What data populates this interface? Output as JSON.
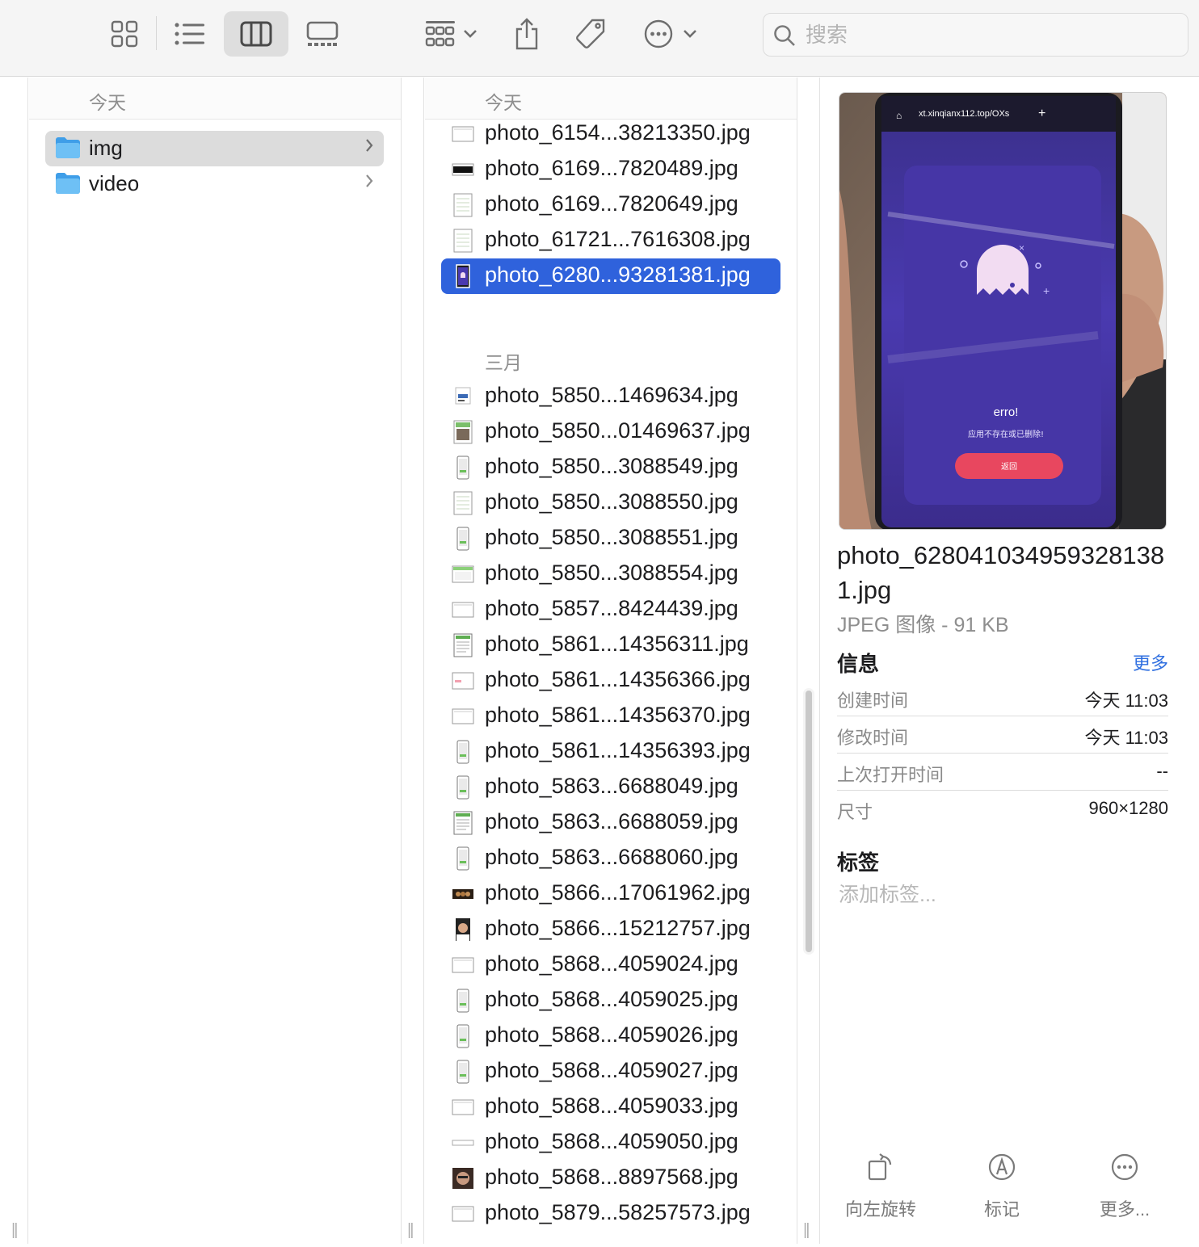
{
  "toolbar": {
    "view_buttons": [
      "icon-view-icon",
      "list-view-icon",
      "column-view-icon",
      "gallery-view-icon"
    ],
    "search_placeholder": "搜索"
  },
  "column1": {
    "header": "今天",
    "items": [
      {
        "label": "img",
        "selected": true
      },
      {
        "label": "video",
        "selected": false
      }
    ]
  },
  "column2": {
    "header": "今天",
    "today_files": [
      {
        "label": "photo_6154...38213350.jpg",
        "thumb": "white"
      },
      {
        "label": "photo_6169...7820489.jpg",
        "thumb": "dark-bar"
      },
      {
        "label": "photo_6169...7820649.jpg",
        "thumb": "doc"
      },
      {
        "label": "photo_61721...7616308.jpg",
        "thumb": "doc"
      },
      {
        "label": "photo_6280...93281381.jpg",
        "thumb": "phone-purple",
        "selected": true
      }
    ],
    "section_march": "三月",
    "march_files": [
      {
        "label": "photo_5850...1469634.jpg",
        "thumb": "small"
      },
      {
        "label": "photo_5850...01469637.jpg",
        "thumb": "photo"
      },
      {
        "label": "photo_5850...3088549.jpg",
        "thumb": "phone"
      },
      {
        "label": "photo_5850...3088550.jpg",
        "thumb": "doc"
      },
      {
        "label": "photo_5850...3088551.jpg",
        "thumb": "phone"
      },
      {
        "label": "photo_5850...3088554.jpg",
        "thumb": "wide-green"
      },
      {
        "label": "photo_5857...8424439.jpg",
        "thumb": "white"
      },
      {
        "label": "photo_5861...14356311.jpg",
        "thumb": "doc-green"
      },
      {
        "label": "photo_5861...14356366.jpg",
        "thumb": "white-pink"
      },
      {
        "label": "photo_5861...14356370.jpg",
        "thumb": "white"
      },
      {
        "label": "photo_5861...14356393.jpg",
        "thumb": "phone"
      },
      {
        "label": "photo_5863...6688049.jpg",
        "thumb": "phone"
      },
      {
        "label": "photo_5863...6688059.jpg",
        "thumb": "doc-green"
      },
      {
        "label": "photo_5863...6688060.jpg",
        "thumb": "phone"
      },
      {
        "label": "photo_5866...17061962.jpg",
        "thumb": "dark-wide"
      },
      {
        "label": "photo_5866...15212757.jpg",
        "thumb": "face"
      },
      {
        "label": "photo_5868...4059024.jpg",
        "thumb": "white"
      },
      {
        "label": "photo_5868...4059025.jpg",
        "thumb": "phone"
      },
      {
        "label": "photo_5868...4059026.jpg",
        "thumb": "phone"
      },
      {
        "label": "photo_5868...4059027.jpg",
        "thumb": "phone"
      },
      {
        "label": "photo_5868...4059033.jpg",
        "thumb": "white"
      },
      {
        "label": "photo_5868...4059050.jpg",
        "thumb": "line"
      },
      {
        "label": "photo_5868...8897568.jpg",
        "thumb": "face-dark"
      },
      {
        "label": "photo_5879...58257573.jpg",
        "thumb": "white"
      }
    ]
  },
  "preview": {
    "image_text": {
      "url": "xt.xinqianx112.top/OXs",
      "error_title": "erro!",
      "error_message": "应用不存在或已删除!",
      "back_button": "返回"
    },
    "filename": "photo_6280410349593281381.jpg",
    "kind_size": "JPEG 图像 - 91 KB",
    "info_title": "信息",
    "more_label": "更多",
    "info_rows": [
      {
        "key": "创建时间",
        "value": "今天 11:03"
      },
      {
        "key": "修改时间",
        "value": "今天 11:03"
      },
      {
        "key": "上次打开时间",
        "value": "--"
      },
      {
        "key": "尺寸",
        "value": "960×1280"
      }
    ],
    "tags_title": "标签",
    "tags_placeholder": "添加标签...",
    "actions": [
      {
        "label": "向左旋转",
        "icon": "rotate-left-icon"
      },
      {
        "label": "标记",
        "icon": "markup-icon"
      },
      {
        "label": "更多...",
        "icon": "more-icon"
      }
    ]
  },
  "colors": {
    "selection_blue": "#2f62dc",
    "folder_blue": "#5fb4f2",
    "link_blue": "#2f6fe0",
    "toolbar_bg": "#f5f5f5"
  }
}
